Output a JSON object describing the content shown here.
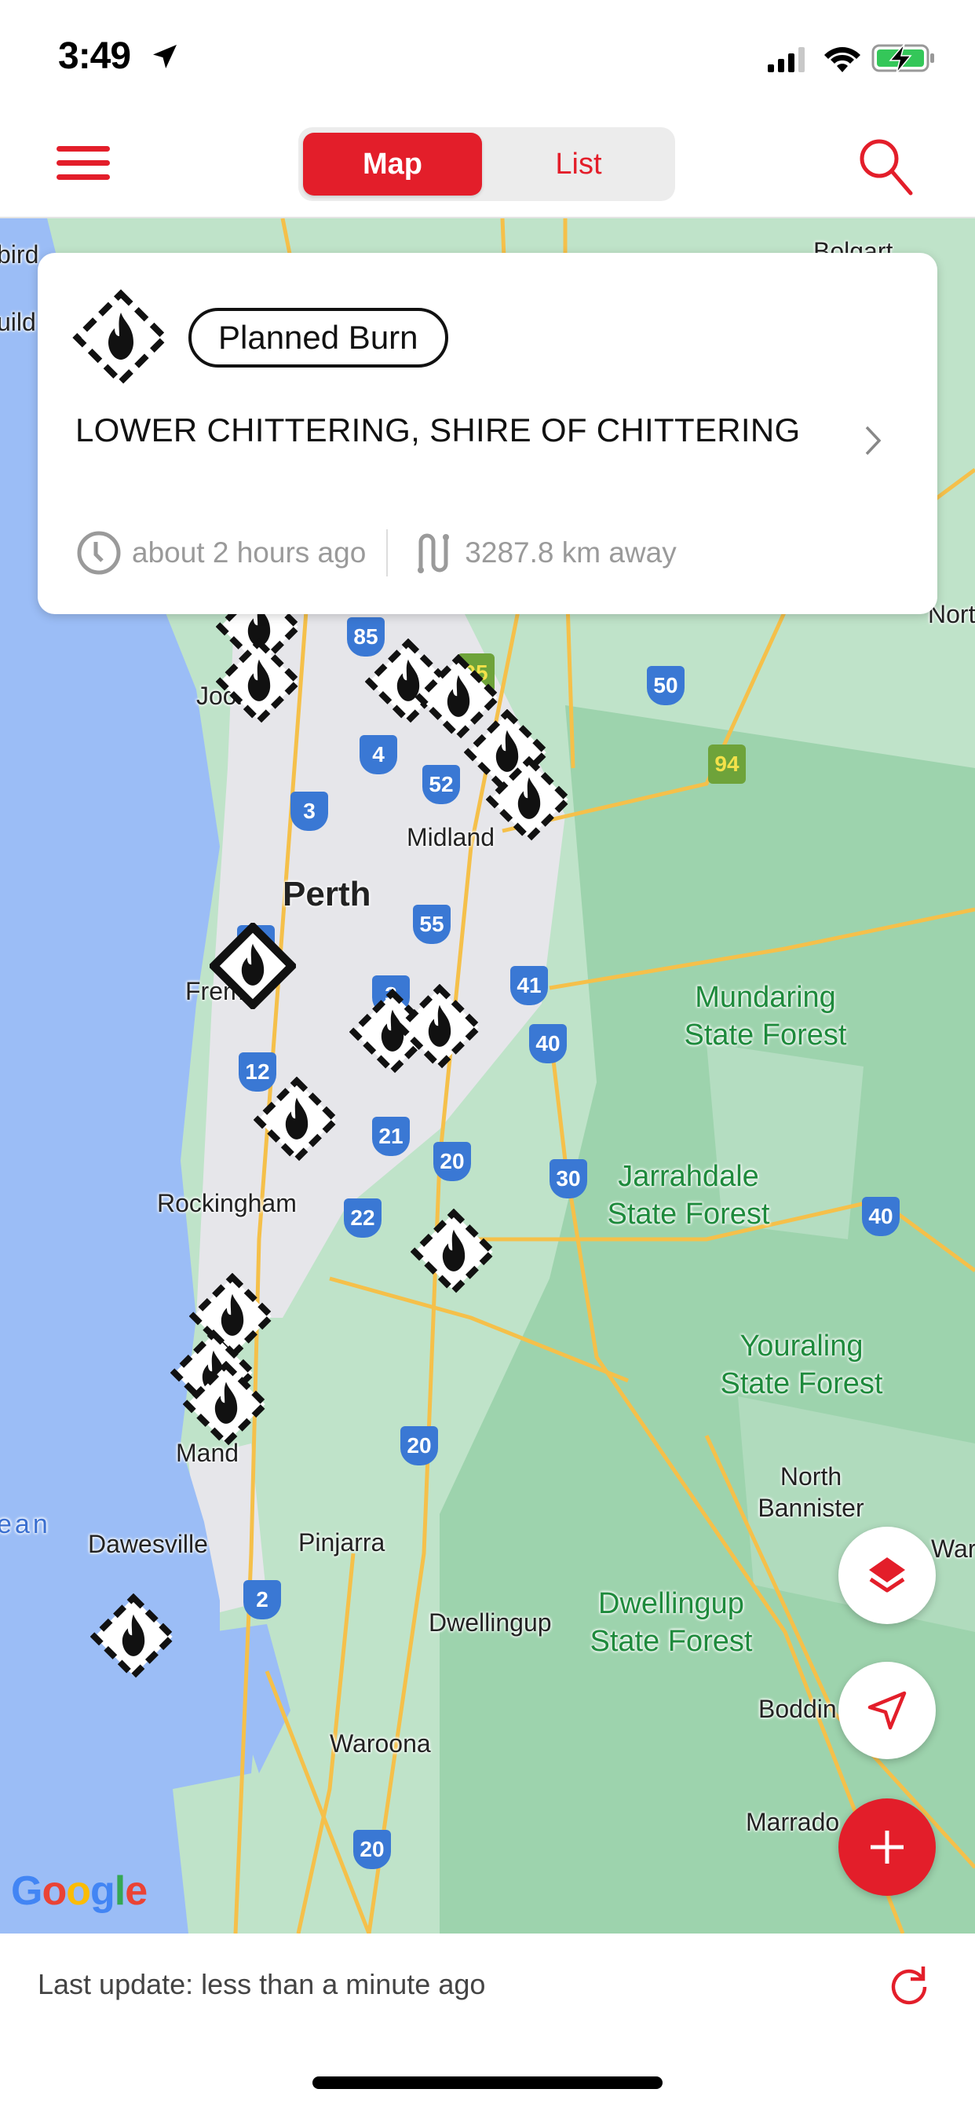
{
  "status_bar": {
    "time": "3:49",
    "icons": [
      "location-arrow-icon",
      "cellular-signal-icon",
      "wifi-icon",
      "battery-charging-icon"
    ]
  },
  "nav": {
    "menu_icon": "hamburger-menu-icon",
    "tabs": [
      {
        "label": "Map",
        "active": true
      },
      {
        "label": "List",
        "active": false
      }
    ],
    "search_icon": "search-icon"
  },
  "colors": {
    "accent": "#e31e2a",
    "map_land": "#bfe3c9",
    "map_water": "#9bbdf6",
    "map_urban": "#e6e6ea",
    "road": "#f5c04a",
    "forest_label": "#1e8a3c"
  },
  "incident_card": {
    "type_icon": "planned-burn-icon",
    "type_label": "Planned Burn",
    "title": "LOWER CHITTERING, SHIRE OF CHITTERING",
    "time_icon": "clock-icon",
    "time_text": "about 2 hours ago",
    "distance_icon": "route-icon",
    "distance_text": "3287.8 km away",
    "chevron_icon": "chevron-right-icon"
  },
  "map": {
    "place_labels": [
      {
        "text": "Perth",
        "kind": "big"
      },
      {
        "text": "Midland",
        "kind": "town"
      },
      {
        "text": "Joondalup",
        "kind": "town",
        "visible_text": "Joona"
      },
      {
        "text": "Fremantle",
        "kind": "town",
        "visible_text": "Frema"
      },
      {
        "text": "Rockingham",
        "kind": "town"
      },
      {
        "text": "Mandurah",
        "kind": "town",
        "visible_text": "Mand"
      },
      {
        "text": "Dawesville",
        "kind": "town"
      },
      {
        "text": "Pinjarra",
        "kind": "town"
      },
      {
        "text": "Dwellingup",
        "kind": "town"
      },
      {
        "text": "Waroona",
        "kind": "town"
      },
      {
        "text": "North Bannister",
        "kind": "town"
      },
      {
        "text": "Boddin",
        "kind": "town"
      },
      {
        "text": "Marrado",
        "kind": "town"
      },
      {
        "text": "Bolgart",
        "kind": "town",
        "visible_text": "Bolgart"
      },
      {
        "text": "bird",
        "kind": "town"
      },
      {
        "text": "uild",
        "kind": "town"
      },
      {
        "text": "Nort",
        "kind": "town"
      },
      {
        "text": "War",
        "kind": "town"
      },
      {
        "text": "ean",
        "kind": "ocean"
      },
      {
        "text": "Mundaring\nState Forest",
        "kind": "forest"
      },
      {
        "text": "Jarrahdale\nState Forest",
        "kind": "forest"
      },
      {
        "text": "Youraling\nState Forest",
        "kind": "forest"
      },
      {
        "text": "Dwellingup\nState Forest",
        "kind": "forest"
      }
    ],
    "route_shields": [
      {
        "num": "85",
        "kind": "blue"
      },
      {
        "num": "95",
        "kind": "green"
      },
      {
        "num": "50",
        "kind": "blue"
      },
      {
        "num": "94",
        "kind": "green"
      },
      {
        "num": "4",
        "kind": "blue"
      },
      {
        "num": "52",
        "kind": "blue"
      },
      {
        "num": "3",
        "kind": "blue"
      },
      {
        "num": "55",
        "kind": "blue"
      },
      {
        "num": "5",
        "kind": "blue"
      },
      {
        "num": "3",
        "kind": "blue"
      },
      {
        "num": "41",
        "kind": "blue"
      },
      {
        "num": "40",
        "kind": "blue"
      },
      {
        "num": "12",
        "kind": "blue"
      },
      {
        "num": "21",
        "kind": "blue"
      },
      {
        "num": "20",
        "kind": "blue"
      },
      {
        "num": "30",
        "kind": "blue"
      },
      {
        "num": "22",
        "kind": "blue"
      },
      {
        "num": "40",
        "kind": "blue"
      },
      {
        "num": "20",
        "kind": "blue"
      },
      {
        "num": "2",
        "kind": "blue"
      },
      {
        "num": "20",
        "kind": "blue"
      }
    ],
    "markers": [
      {
        "style": "dashed",
        "label": "planned-burn"
      },
      {
        "style": "dashed",
        "label": "planned-burn"
      },
      {
        "style": "dashed",
        "label": "planned-burn"
      },
      {
        "style": "dashed",
        "label": "planned-burn"
      },
      {
        "style": "dashed",
        "label": "planned-burn"
      },
      {
        "style": "dashed",
        "label": "planned-burn"
      },
      {
        "style": "solid",
        "label": "bushfire-advice"
      },
      {
        "style": "dashed",
        "label": "planned-burn"
      },
      {
        "style": "dashed",
        "label": "planned-burn"
      },
      {
        "style": "dashed",
        "label": "planned-burn"
      },
      {
        "style": "dashed",
        "label": "planned-burn"
      },
      {
        "style": "dashed",
        "label": "planned-burn"
      },
      {
        "style": "dashed",
        "label": "planned-burn"
      },
      {
        "style": "dashed",
        "label": "planned-burn"
      },
      {
        "style": "dashed",
        "label": "planned-burn"
      }
    ],
    "attribution": "Google",
    "controls": {
      "layers_icon": "layers-icon",
      "locate_icon": "navigation-arrow-icon",
      "add_icon": "plus-icon"
    }
  },
  "footer": {
    "last_update": "Last update: less than a minute ago",
    "refresh_icon": "refresh-icon"
  }
}
